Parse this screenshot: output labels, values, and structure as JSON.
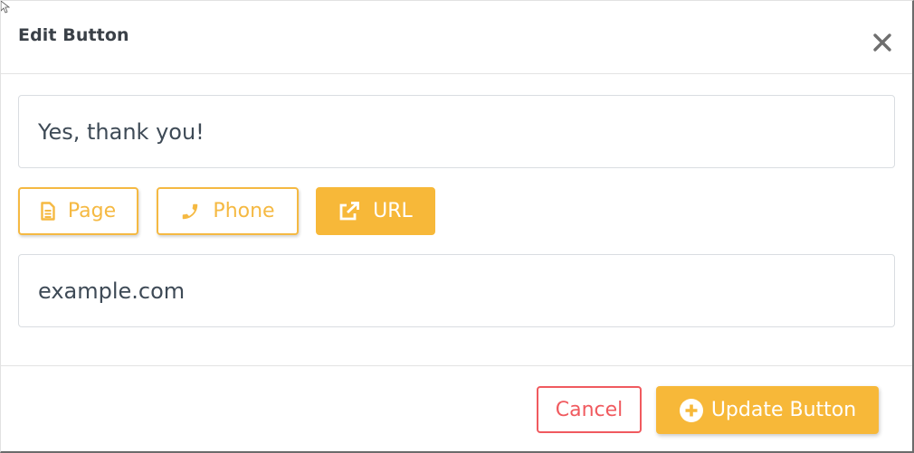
{
  "dialog": {
    "title": "Edit Button",
    "close_icon": "close-icon"
  },
  "form": {
    "label_value": "Yes, thank you!",
    "types": [
      {
        "label": "Page",
        "icon": "document-icon",
        "active": false
      },
      {
        "label": "Phone",
        "icon": "phone-icon",
        "active": false
      },
      {
        "label": "URL",
        "icon": "external-link-icon",
        "active": true
      }
    ],
    "url_value": "example.com"
  },
  "footer": {
    "cancel_label": "Cancel",
    "update_label": "Update Button",
    "update_icon": "plus-circle-icon"
  },
  "colors": {
    "accent": "#f7b839",
    "danger": "#f05a5f",
    "text": "#3e4a56"
  }
}
